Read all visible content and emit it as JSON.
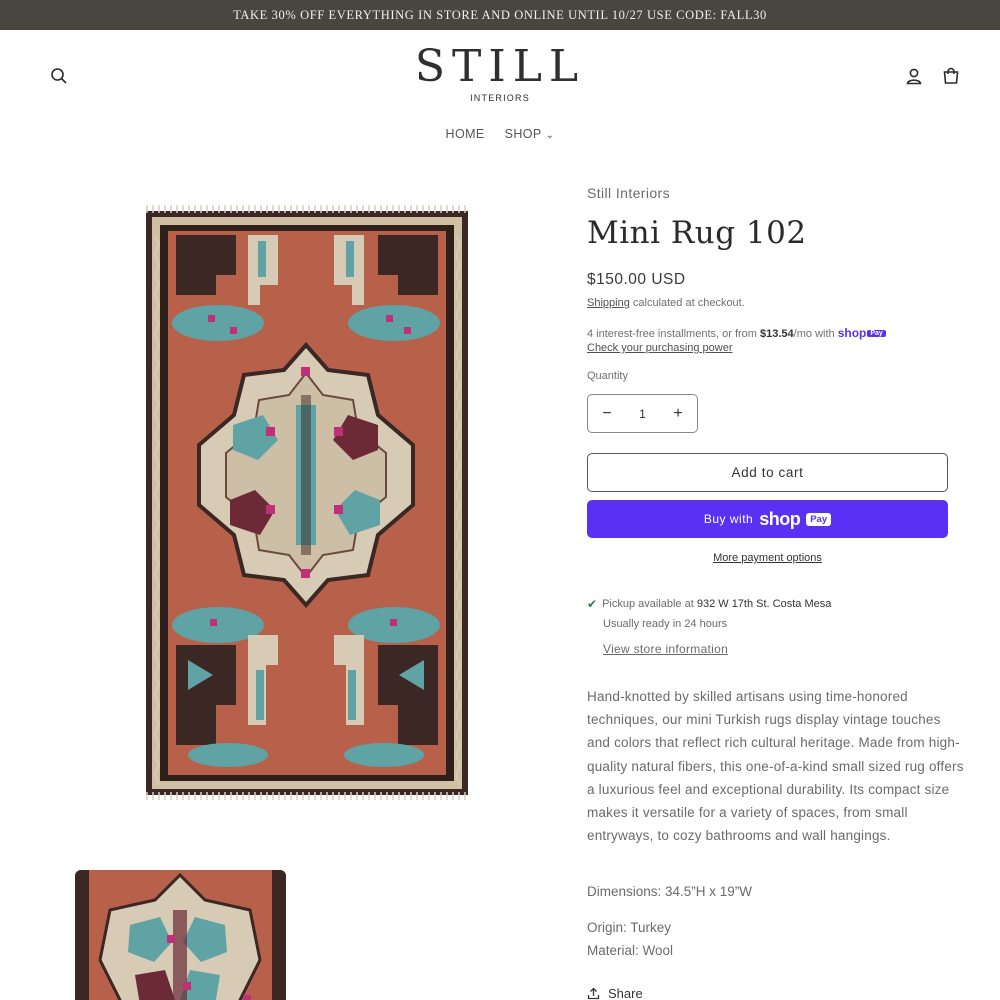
{
  "announcement": "TAKE 30% OFF EVERYTHING IN STORE AND ONLINE UNTIL 10/27 USE CODE: FALL30",
  "header": {
    "logo_main": "STILL",
    "logo_sub": "INTERIORS",
    "icons": [
      "search-icon",
      "account-icon",
      "cart-icon"
    ]
  },
  "nav": {
    "items": [
      {
        "label": "HOME"
      },
      {
        "label": "SHOP",
        "has_dropdown": true
      }
    ]
  },
  "product": {
    "vendor": "Still Interiors",
    "title": "Mini Rug 102",
    "price": "$150.00 USD",
    "shipping_link": "Shipping",
    "shipping_text": " calculated at checkout.",
    "installments_pre": "4 interest-free installments, or from ",
    "installments_amount": "$13.54",
    "installments_post": "/mo with ",
    "shop_word": "shop",
    "pay_word": "Pay",
    "check_power": "Check your purchasing power",
    "quantity_label": "Quantity",
    "quantity_value": "1",
    "qty_minus": "−",
    "qty_plus": "+",
    "add_to_cart": "Add to cart",
    "buy_with": "Buy with",
    "more_payment": "More payment options",
    "pickup_prefix": "Pickup available at ",
    "pickup_location": "932 W 17th St. Costa Mesa",
    "ready_text": "Usually ready in 24 hours",
    "store_info": "View store information",
    "description": "Hand-knotted by skilled artisans using time-honored techniques, our mini Turkish rugs display vintage touches and colors that reflect rich cultural heritage. Made from high-quality natural fibers, this one-of-a-kind small sized rug offers a luxurious feel and exceptional durability. Its compact size makes it versatile for a variety of spaces, from small entryways, to cozy bathrooms and wall hangings.",
    "dimensions": "Dimensions: 34.5”H x 19”W",
    "origin": "Origin: Turkey",
    "material": "Material: Wool",
    "share": "Share"
  },
  "colors": {
    "announcement_bg": "#48463f",
    "shop_pay": "#5a31f4",
    "rug_field": "#b8614a",
    "rug_teal": "#5fa3a4",
    "rug_cream": "#d8cbb5",
    "rug_dark": "#3b2723"
  }
}
